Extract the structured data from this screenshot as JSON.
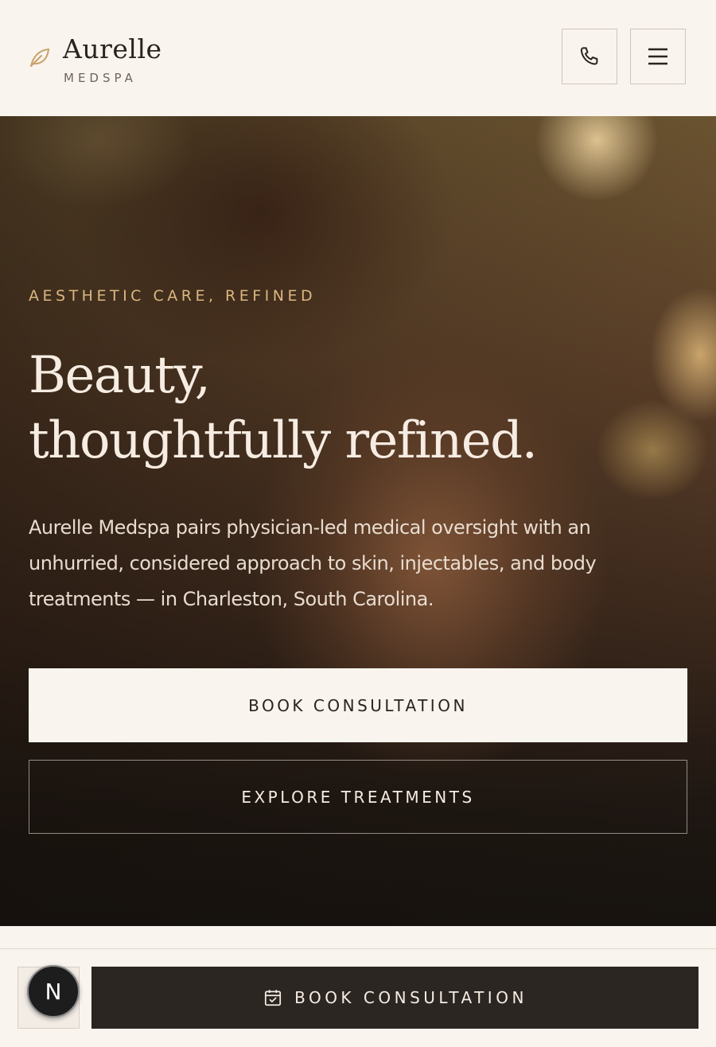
{
  "header": {
    "brand_name": "Aurelle",
    "brand_sub": "MEDSPA",
    "logo_icon": "leaf-icon",
    "phone_icon": "phone-icon",
    "menu_icon": "hamburger-menu-icon"
  },
  "hero": {
    "eyebrow": "AESTHETIC CARE, REFINED",
    "headline_line1": "Beauty,",
    "headline_line2": "thoughtfully refined.",
    "lead": "Aurelle Medspa pairs physician-led medical oversight with an unhurried, considered approach to skin, injectables, and body treatments — in Charleston, South Carolina.",
    "primary_cta": "BOOK CONSULTATION",
    "secondary_cta": "EXPLORE TREATMENTS"
  },
  "bottom_bar": {
    "badge_letter": "N",
    "book_label": "BOOK CONSULTATION",
    "book_icon": "calendar-check-icon"
  },
  "colors": {
    "background": "#faf4ee",
    "text_dark": "#2a2420",
    "accent_gold": "#d9b780",
    "bar_dark": "#2b2622",
    "leaf": "#c8a36b"
  }
}
